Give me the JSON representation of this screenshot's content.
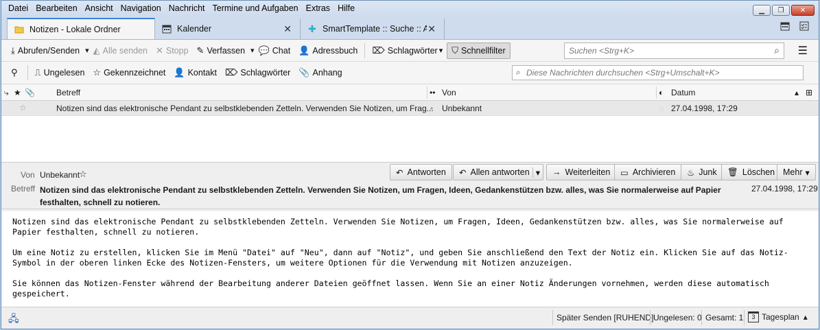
{
  "menubar": {
    "items": [
      "Datei",
      "Bearbeiten",
      "Ansicht",
      "Navigation",
      "Nachricht",
      "Termine und Aufgaben",
      "Extras",
      "Hilfe"
    ]
  },
  "tabs": [
    {
      "label": "Notizen - Lokale Ordner",
      "icon": "folder-icon"
    },
    {
      "label": "Kalender",
      "icon": "calendar-icon"
    },
    {
      "label": "SmartTemplate :: Suche :: Ac",
      "icon": "puzzle-icon"
    }
  ],
  "toolbar": {
    "get_messages": "Abrufen/Senden",
    "send_all": "Alle senden",
    "stop": "Stopp",
    "compose": "Verfassen",
    "chat": "Chat",
    "address_book": "Adressbuch",
    "tags": "Schlagwörter",
    "quick_filter": "Schnellfilter",
    "search_placeholder": "Suchen <Strg+K>"
  },
  "filterbar": {
    "unread": "Ungelesen",
    "starred": "Gekennzeichnet",
    "contact": "Kontakt",
    "tags": "Schlagwörter",
    "attachment": "Anhang",
    "search_placeholder": "Diese Nachrichten durchsuchen <Strg+Umschalt+K>"
  },
  "thread_columns": {
    "subject": "Betreff",
    "from": "Von",
    "date": "Datum"
  },
  "messages": [
    {
      "subject": "Notizen sind das elektronische Pendant zu selbstklebenden Zetteln. Verwenden Sie Notizen, um Frag...",
      "from": "Unbekannt",
      "date": "27.04.1998, 17:29"
    }
  ],
  "header": {
    "from_label": "Von",
    "from_value": "Unbekannt",
    "subject_label": "Betreff",
    "subject_value": "Notizen sind das elektronische Pendant zu selbstklebenden Zetteln. Verwenden Sie Notizen, um Fragen, Ideen, Gedankenstützen bzw. alles, was Sie normalerweise auf Papier festhalten, schnell zu notieren.",
    "date": "27.04.1998, 17:29",
    "buttons": {
      "reply": "Antworten",
      "reply_all": "Allen antworten",
      "forward": "Weiterleiten",
      "archive": "Archivieren",
      "junk": "Junk",
      "delete": "Löschen",
      "more": "Mehr"
    }
  },
  "body": {
    "p1": "Notizen sind das elektronische Pendant zu selbstklebenden Zetteln. Verwenden Sie Notizen, um Fragen, Ideen, Gedankenstützen bzw. alles, was Sie normalerweise auf\nPapier festhalten, schnell zu notieren.",
    "p2": "Um eine Notiz zu erstellen, klicken Sie im Menü \"Datei\" auf \"Neu\", dann auf \"Notiz\", und geben Sie anschließend den Text der Notiz ein. Klicken Sie auf das Notiz-\nSymbol in der oberen linken Ecke des Notizen-Fensters, um weitere Optionen für die Verwendung mit Notizen anzuzeigen.",
    "p3": "Sie können das Notizen-Fenster während der Bearbeitung anderer Dateien geöffnet lassen. Wenn Sie an einer Notiz Änderungen vornehmen, werden diese automatisch\ngespeichert."
  },
  "status": {
    "send_later": "Später Senden [RUHEND]",
    "unread": "Ungelesen: 0",
    "total": "Gesamt: 1",
    "today_pane": "Tagesplan",
    "today_day": "3"
  }
}
